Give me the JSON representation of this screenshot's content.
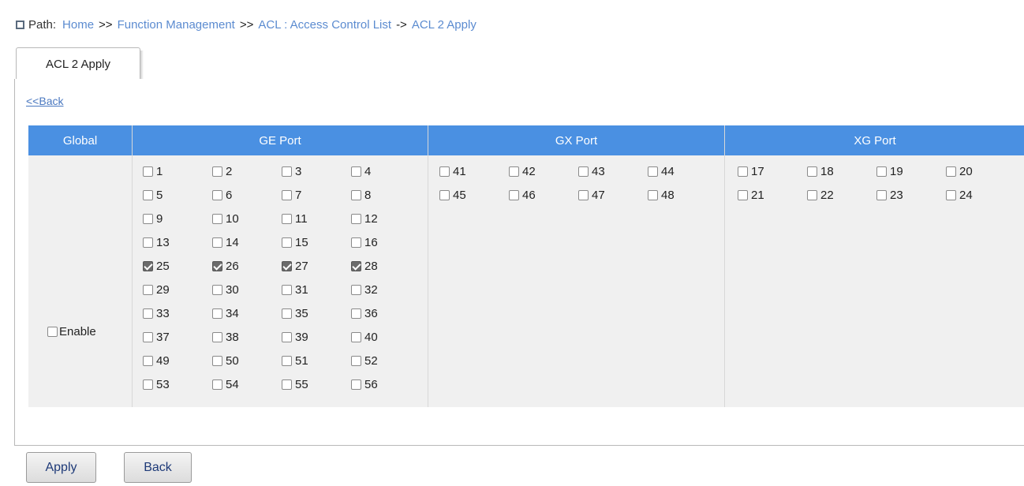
{
  "path": {
    "label": "Path:",
    "crumbs": [
      "Home",
      "Function Management",
      "ACL : Access Control List",
      "ACL 2 Apply"
    ],
    "separators": [
      ">>",
      ">>",
      "->"
    ]
  },
  "tab": {
    "label": "ACL 2 Apply"
  },
  "back_link": "<<Back",
  "table": {
    "headers": {
      "global": "Global",
      "ge": "GE Port",
      "gx": "GX Port",
      "xg": "XG Port"
    },
    "global_enable": {
      "label": "Enable",
      "checked": false
    },
    "ge_ports": [
      [
        {
          "n": "1",
          "c": false
        },
        {
          "n": "2",
          "c": false
        },
        {
          "n": "3",
          "c": false
        },
        {
          "n": "4",
          "c": false
        }
      ],
      [
        {
          "n": "5",
          "c": false
        },
        {
          "n": "6",
          "c": false
        },
        {
          "n": "7",
          "c": false
        },
        {
          "n": "8",
          "c": false
        }
      ],
      [
        {
          "n": "9",
          "c": false
        },
        {
          "n": "10",
          "c": false
        },
        {
          "n": "11",
          "c": false
        },
        {
          "n": "12",
          "c": false
        }
      ],
      [
        {
          "n": "13",
          "c": false
        },
        {
          "n": "14",
          "c": false
        },
        {
          "n": "15",
          "c": false
        },
        {
          "n": "16",
          "c": false
        }
      ],
      [
        {
          "n": "25",
          "c": true
        },
        {
          "n": "26",
          "c": true
        },
        {
          "n": "27",
          "c": true
        },
        {
          "n": "28",
          "c": true
        }
      ],
      [
        {
          "n": "29",
          "c": false
        },
        {
          "n": "30",
          "c": false
        },
        {
          "n": "31",
          "c": false
        },
        {
          "n": "32",
          "c": false
        }
      ],
      [
        {
          "n": "33",
          "c": false
        },
        {
          "n": "34",
          "c": false
        },
        {
          "n": "35",
          "c": false
        },
        {
          "n": "36",
          "c": false
        }
      ],
      [
        {
          "n": "37",
          "c": false
        },
        {
          "n": "38",
          "c": false
        },
        {
          "n": "39",
          "c": false
        },
        {
          "n": "40",
          "c": false
        }
      ],
      [
        {
          "n": "49",
          "c": false
        },
        {
          "n": "50",
          "c": false
        },
        {
          "n": "51",
          "c": false
        },
        {
          "n": "52",
          "c": false
        }
      ],
      [
        {
          "n": "53",
          "c": false
        },
        {
          "n": "54",
          "c": false
        },
        {
          "n": "55",
          "c": false
        },
        {
          "n": "56",
          "c": false
        }
      ]
    ],
    "gx_ports": [
      [
        {
          "n": "41",
          "c": false
        },
        {
          "n": "42",
          "c": false
        },
        {
          "n": "43",
          "c": false
        },
        {
          "n": "44",
          "c": false
        }
      ],
      [
        {
          "n": "45",
          "c": false
        },
        {
          "n": "46",
          "c": false
        },
        {
          "n": "47",
          "c": false
        },
        {
          "n": "48",
          "c": false
        }
      ]
    ],
    "xg_ports": [
      [
        {
          "n": "17",
          "c": false
        },
        {
          "n": "18",
          "c": false
        },
        {
          "n": "19",
          "c": false
        },
        {
          "n": "20",
          "c": false
        }
      ],
      [
        {
          "n": "21",
          "c": false
        },
        {
          "n": "22",
          "c": false
        },
        {
          "n": "23",
          "c": false
        },
        {
          "n": "24",
          "c": false
        }
      ]
    ]
  },
  "buttons": {
    "apply": "Apply",
    "back": "Back"
  },
  "colors": {
    "header_bg": "#4a90e2",
    "link": "#5b8bd0",
    "table_bg": "#f0f0f0",
    "button_text": "#1e3a78"
  }
}
